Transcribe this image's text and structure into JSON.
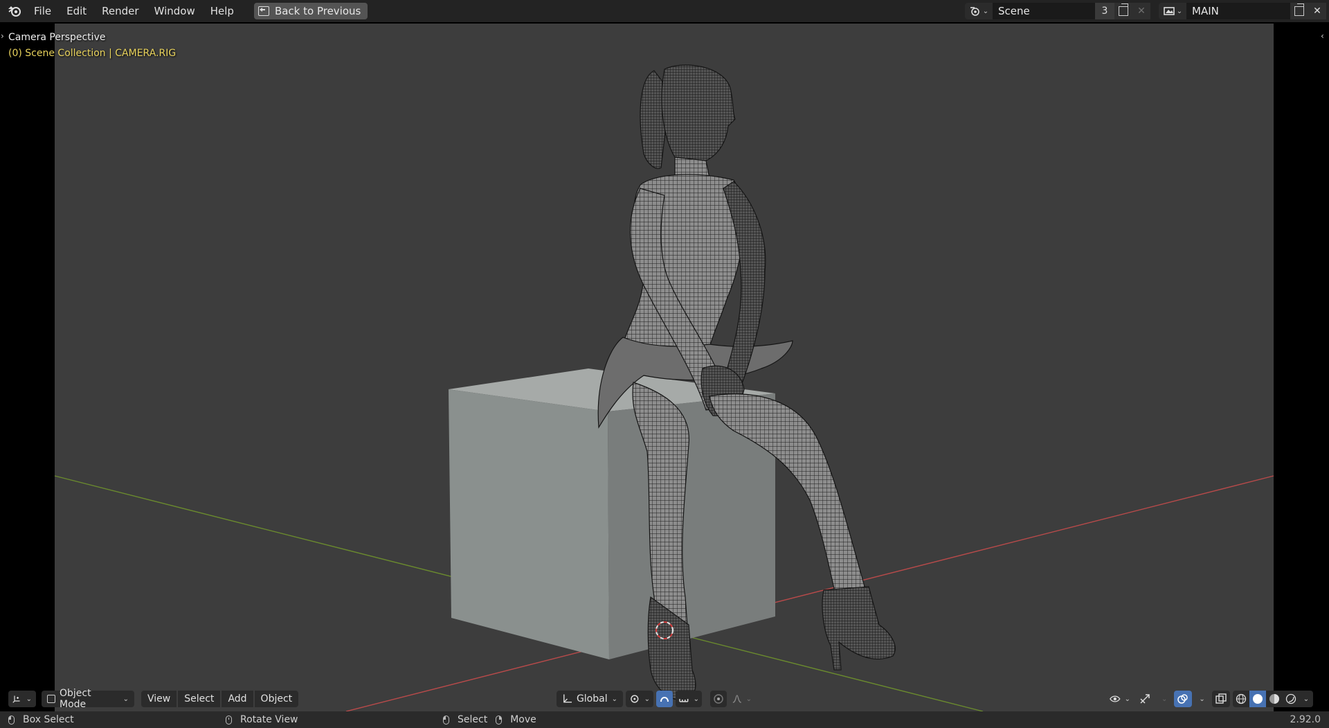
{
  "topbar": {
    "menus": [
      "File",
      "Edit",
      "Render",
      "Window",
      "Help"
    ],
    "back_button": "Back to Previous",
    "scene_name": "Scene",
    "scene_users": "3",
    "view_layer": "MAIN"
  },
  "viewport": {
    "title": "Camera Perspective",
    "collection_info": "(0) Scene Collection | CAMERA.RIG",
    "colors": {
      "background": "#3d3d3d",
      "x_axis": "#b84a4a",
      "y_axis": "#6a8a2e",
      "cube_left": "#8b918f",
      "cube_right": "#7a7d7c",
      "cube_top": "#a5a9a7",
      "wire": "#1a1a1a"
    },
    "icons": [
      "blender-logo-icon",
      "viewport-expand-left-icon",
      "viewport-expand-right-icon",
      "3d-cursor-icon"
    ]
  },
  "header": {
    "editor_type_icon": "3d-viewport-icon",
    "mode": "Object Mode",
    "menus": [
      "View",
      "Select",
      "Add",
      "Object"
    ],
    "transform_orientation": "Global",
    "icons": [
      "pivot-icon",
      "snap-icon",
      "snap-increment-icon",
      "proportional-edit-icon",
      "falloff-icon",
      "visibility-icon",
      "gizmo-icon",
      "overlay-icon",
      "xray-icon",
      "wireframe-shading-icon",
      "solid-shading-icon",
      "material-shading-icon",
      "rendered-shading-icon"
    ]
  },
  "statusbar": {
    "left_action": "Box Select",
    "middle_action": "Rotate View",
    "right_action_1": "Select",
    "right_action_2": "Move",
    "version": "2.92.0"
  }
}
